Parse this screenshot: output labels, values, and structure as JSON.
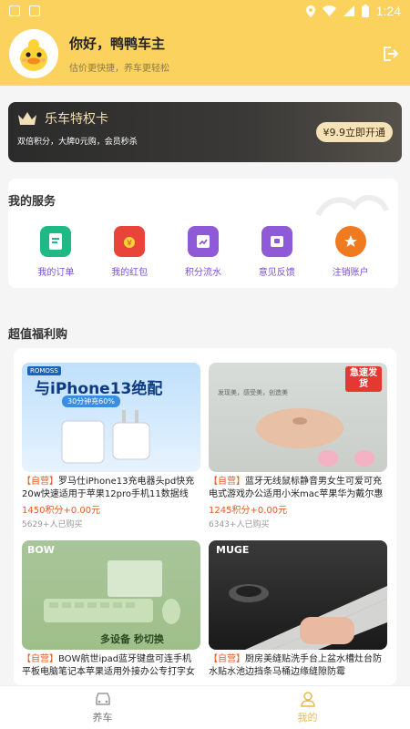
{
  "status_bar": {
    "time": "1:24"
  },
  "user": {
    "greeting": "你好，鸭鸭车主",
    "subtitle": "估价更快捷，养车更轻松"
  },
  "vip": {
    "title": "乐车特权卡",
    "desc": "双倍积分，大牌0元购，会员秒杀",
    "button": "¥9.9立即开通"
  },
  "services": {
    "title": "我的服务",
    "items": [
      {
        "label": "我的订单",
        "icon": "order-icon",
        "color": "#1fb985"
      },
      {
        "label": "我的红包",
        "icon": "red-envelope-icon",
        "color": "#e9443a"
      },
      {
        "label": "积分流水",
        "icon": "points-icon",
        "color": "#8e5ad8"
      },
      {
        "label": "意见反馈",
        "icon": "feedback-icon",
        "color": "#8e5ad8"
      },
      {
        "label": "注销账户",
        "icon": "cancel-account-icon",
        "color": "#f07a1f"
      }
    ]
  },
  "benefits": {
    "title": "超值福利购",
    "products": [
      {
        "tag": "【自营】",
        "name": "罗马仕iPhone13充电器头pd快充20w快速适用于苹果12pro手机11数据线",
        "price": "1450积分+0.00元",
        "sold": "5629+人已购买",
        "image_text": "与iPhone13绝配",
        "image_sub": "30分钟充60%",
        "brand": "ROMOSS"
      },
      {
        "tag": "【自营】",
        "name": "蓝牙无线鼠标静音男女生可爱可充电式游戏办公适用小米mac苹果华为戴尔惠",
        "price": "1245积分+0.00元",
        "sold": "6343+人已购买",
        "image_text": "急速发货",
        "image_sub": "发现美，感受美，创造美"
      },
      {
        "tag": "【自营】",
        "name": "BOW航世ipad蓝牙键盘可连手机平板电脑笔记本苹果适用外接办公专打字女生",
        "price": "",
        "sold": "",
        "image_text": "多设备 秒切换",
        "image_sub": "",
        "brand": "BOW"
      },
      {
        "tag": "【自营】",
        "name": "厨房美缝贴洗手台上盆水槽灶台防水贴水池边挡条马桶边缘缝隙防霉",
        "price": "",
        "sold": "",
        "image_text": "MUGE",
        "image_sub": ""
      }
    ]
  },
  "tabs": [
    {
      "label": "养车",
      "active": false
    },
    {
      "label": "我的",
      "active": true
    }
  ],
  "colors": {
    "accent": "#fcd25e",
    "price": "#e55b24",
    "active_tab": "#e8b94a"
  }
}
